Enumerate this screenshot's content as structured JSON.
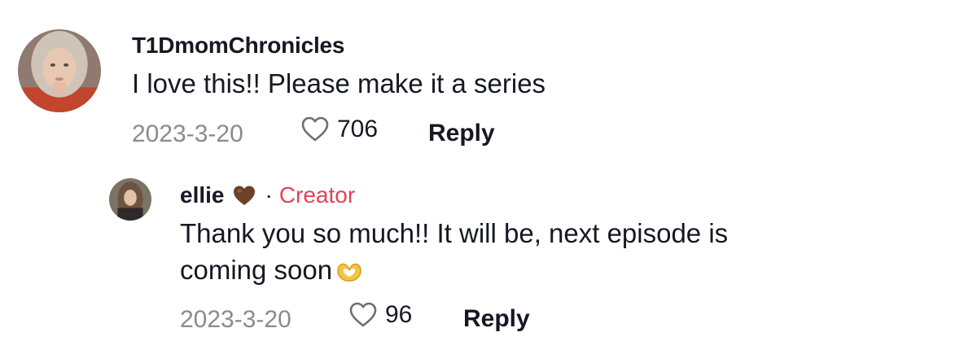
{
  "comments": [
    {
      "username": "T1DmomChronicles",
      "text": "I love this!! Please make it a series",
      "date": "2023-3-20",
      "likes": "706",
      "reply_label": "Reply"
    }
  ],
  "reply": {
    "username": "ellie",
    "username_emoji": "brown-heart-emoji",
    "separator": "·",
    "badge": "Creator",
    "text_lines": [
      "Thank you so much!! It will be, next episode is",
      "coming soon"
    ],
    "text_emoji": "heart-hands-emoji",
    "date": "2023-3-20",
    "likes": "96",
    "reply_label": "Reply"
  },
  "colors": {
    "creator_badge": "#e0435a",
    "meta_gray": "#8a8b91",
    "text": "#161823"
  }
}
